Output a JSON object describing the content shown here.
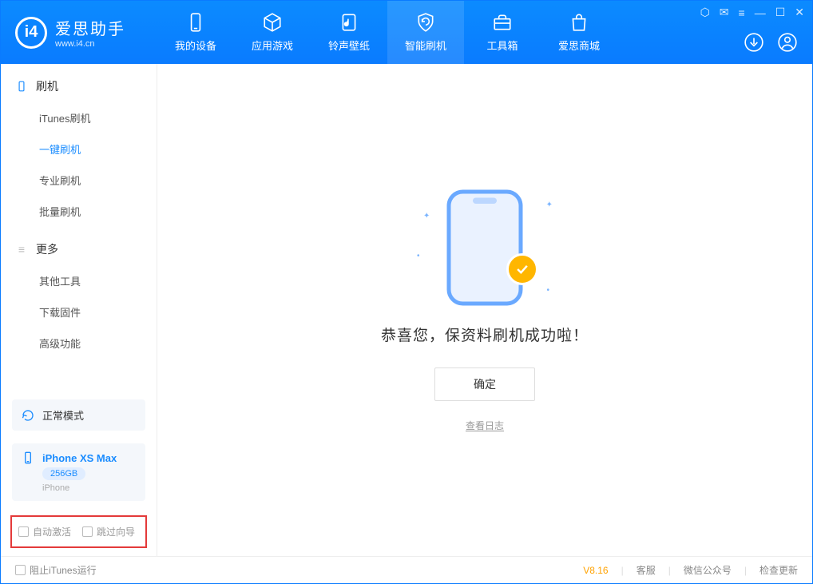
{
  "app": {
    "name_cn": "爱思助手",
    "url": "www.i4.cn"
  },
  "nav": [
    {
      "key": "device",
      "label": "我的设备"
    },
    {
      "key": "apps",
      "label": "应用游戏"
    },
    {
      "key": "media",
      "label": "铃声壁纸"
    },
    {
      "key": "flash",
      "label": "智能刷机",
      "active": true
    },
    {
      "key": "tools",
      "label": "工具箱"
    },
    {
      "key": "store",
      "label": "爱思商城"
    }
  ],
  "sidebar": {
    "group1_title": "刷机",
    "items1": [
      {
        "label": "iTunes刷机"
      },
      {
        "label": "一键刷机",
        "active": true
      },
      {
        "label": "专业刷机"
      },
      {
        "label": "批量刷机"
      }
    ],
    "group2_title": "更多",
    "items2": [
      {
        "label": "其他工具"
      },
      {
        "label": "下载固件"
      },
      {
        "label": "高级功能"
      }
    ],
    "mode_label": "正常模式",
    "device_name": "iPhone XS Max",
    "capacity": "256GB",
    "device_type": "iPhone",
    "opt_auto_activate": "自动激活",
    "opt_skip_guide": "跳过向导"
  },
  "main": {
    "message": "恭喜您，保资料刷机成功啦！",
    "ok_label": "确定",
    "view_log": "查看日志"
  },
  "footer": {
    "block_itunes": "阻止iTunes运行",
    "version": "V8.16",
    "link_support": "客服",
    "link_wechat": "微信公众号",
    "link_update": "检查更新"
  }
}
